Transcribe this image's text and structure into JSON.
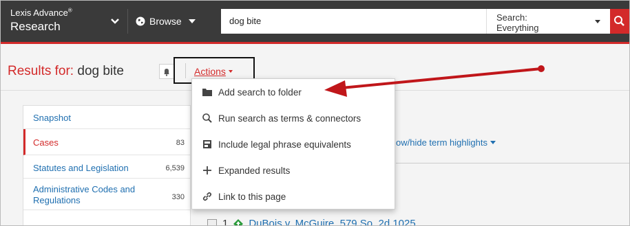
{
  "app": {
    "brand_line1": "Lexis Advance",
    "brand_mark": "®",
    "brand_line2": "Research"
  },
  "nav": {
    "browse_label": "Browse"
  },
  "search": {
    "query": "dog bite",
    "scope_label": "Search:",
    "scope_value": "Everything"
  },
  "results": {
    "prefix": "Results for: ",
    "query": "dog bite",
    "actions_label": "Actions"
  },
  "sidebar": {
    "items": [
      {
        "label": "Snapshot",
        "count": ""
      },
      {
        "label": "Cases",
        "count": "83"
      },
      {
        "label": "Statutes and Legislation",
        "count": "6,539"
      },
      {
        "label": "Administrative Codes and Regulations",
        "count": "330"
      }
    ]
  },
  "content": {
    "highlight_toggle": "ow/hide term highlights",
    "first_result_number": "1",
    "first_result_title": "DuBois v. McGuire, 579 So. 2d 1025"
  },
  "actions_menu": {
    "items": [
      {
        "label": "Add search to folder",
        "icon": "folder-icon"
      },
      {
        "label": "Run search as terms & connectors",
        "icon": "search-icon"
      },
      {
        "label": "Include legal phrase equivalents",
        "icon": "phrase-equivalents-icon"
      },
      {
        "label": "Expanded results",
        "icon": "plus-icon"
      },
      {
        "label": "Link to this page",
        "icon": "link-icon"
      }
    ]
  },
  "colors": {
    "accent_red": "#d32a2a",
    "nav_bg": "#3a3a3a",
    "link_blue": "#1f6fb0",
    "annotation_arrow": "#c0161a"
  }
}
